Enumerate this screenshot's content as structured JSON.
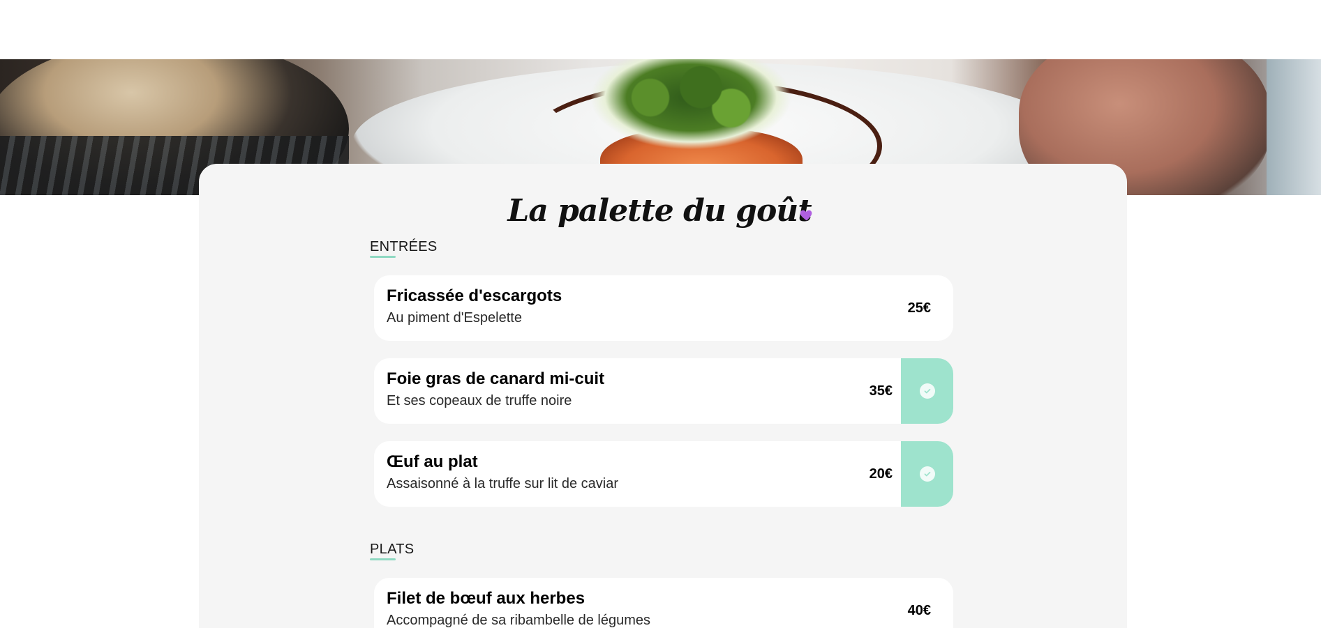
{
  "restaurant": {
    "title": "La palette du goût"
  },
  "hero": {
    "image_description": "food-photo-banner"
  },
  "colors": {
    "accent": "#9ee3cd",
    "underline": "#8fd9c2",
    "heart": "#b05fe0",
    "card_bg": "#f5f5f5"
  },
  "sections": [
    {
      "label": "ENTRÉES",
      "items": [
        {
          "name": "Fricassée d'escargots",
          "description": "Au piment d'Espelette",
          "price": "25€",
          "selected": false
        },
        {
          "name": "Foie gras de canard mi-cuit",
          "description": "Et ses copeaux de truffe noire",
          "price": "35€",
          "selected": true
        },
        {
          "name": "Œuf au plat",
          "description": "Assaisonné à la truffe sur lit de caviar",
          "price": "20€",
          "selected": true
        }
      ]
    },
    {
      "label": "PLATS",
      "items": [
        {
          "name": "Filet de bœuf aux herbes",
          "description": "Accompagné de sa ribambelle de légumes",
          "price": "40€",
          "selected": false
        }
      ]
    }
  ]
}
